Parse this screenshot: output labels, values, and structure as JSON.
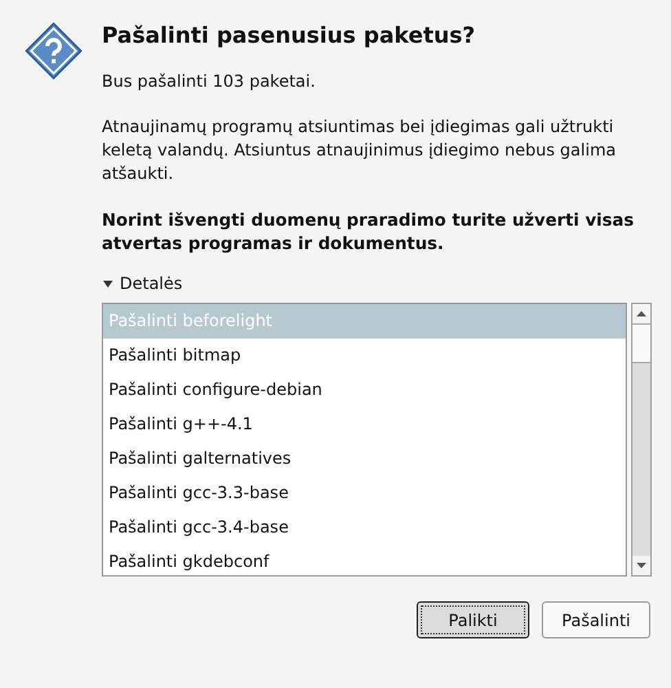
{
  "dialog": {
    "title": "Pašalinti pasenusius paketus?",
    "summary": "Bus pašalinti 103 paketai.",
    "description": "Atnaujinamų programų atsiuntimas bei įdiegimas gali užtrukti keletą valandų. Atsiuntus atnaujinimus įdiegimo nebus galima atšaukti.",
    "warning": "Norint išvengti duomenų praradimo turite užverti visas atvertas programas ir dokumentus."
  },
  "details": {
    "label": "Detalės",
    "expanded": true,
    "items": [
      {
        "label": "Pašalinti beforelight",
        "selected": true
      },
      {
        "label": "Pašalinti bitmap",
        "selected": false
      },
      {
        "label": "Pašalinti configure-debian",
        "selected": false
      },
      {
        "label": "Pašalinti g++-4.1",
        "selected": false
      },
      {
        "label": "Pašalinti galternatives",
        "selected": false
      },
      {
        "label": "Pašalinti gcc-3.3-base",
        "selected": false
      },
      {
        "label": "Pašalinti gcc-3.4-base",
        "selected": false
      },
      {
        "label": "Pašalinti gkdebconf",
        "selected": false
      }
    ]
  },
  "buttons": [
    {
      "label": "Palikti",
      "default": true
    },
    {
      "label": "Pašalinti",
      "default": false
    }
  ]
}
